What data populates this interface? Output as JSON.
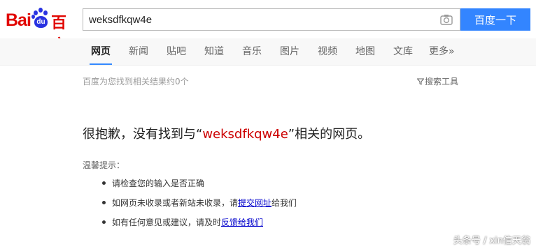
{
  "logo": {
    "text_latin": "Bai",
    "text_paw": "du",
    "text_cn": "百度"
  },
  "search": {
    "query": "weksdfkqw4e",
    "button_label": "百度一下"
  },
  "nav": {
    "items": [
      {
        "label": "网页"
      },
      {
        "label": "新闻"
      },
      {
        "label": "贴吧"
      },
      {
        "label": "知道"
      },
      {
        "label": "音乐"
      },
      {
        "label": "图片"
      },
      {
        "label": "视频"
      },
      {
        "label": "地图"
      },
      {
        "label": "文库"
      },
      {
        "label": "更多»"
      }
    ],
    "active": "网页"
  },
  "results": {
    "count_text": "百度为您找到相关结果约0个",
    "tools_label": "搜索工具"
  },
  "no_result": {
    "prefix": "很抱歉，没有找到与“",
    "keyword": "weksdfkqw4e",
    "suffix": "”相关的网页。"
  },
  "tips": {
    "title": "温馨提示：",
    "item1": "请检查您的输入是否正确",
    "item2_prefix": "如网页未收录或者新站未收录，请",
    "item2_link": "提交网址",
    "item2_suffix": "给我们",
    "item3_prefix": "如有任何意见或建议，请及时",
    "item3_link": "反馈给我们"
  },
  "watermark": "头条号 / xin信天翁",
  "colors": {
    "brand_red": "#e10601",
    "brand_blue": "#2932e1",
    "button_blue": "#3385ff",
    "keyword_red": "#cc0000",
    "link_blue": "#0000cc"
  }
}
